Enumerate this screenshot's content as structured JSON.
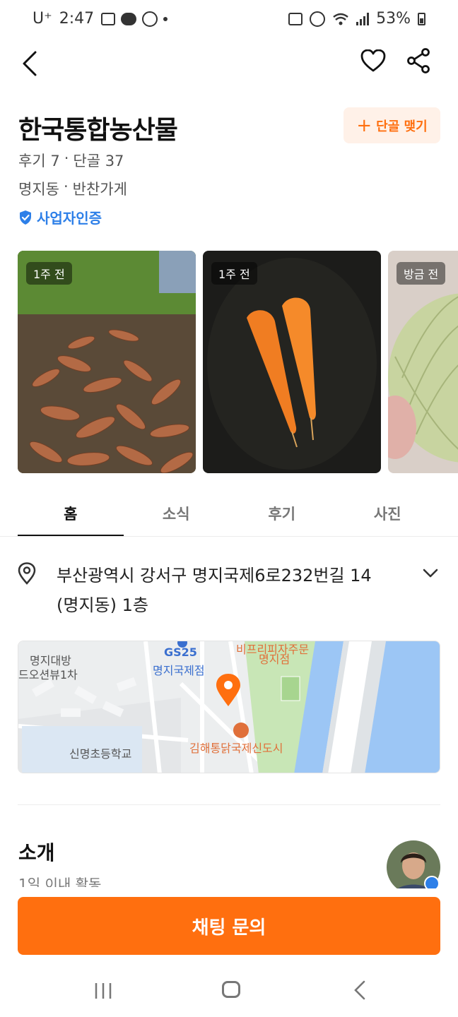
{
  "status_bar": {
    "carrier": "U⁺",
    "time": "2:47",
    "battery": "53%"
  },
  "header": {
    "back_icon": "chevron-left-icon",
    "like_icon": "heart-icon",
    "share_icon": "share-icon"
  },
  "store": {
    "name": "한국통합농산물",
    "regular_button": "단골 맺기",
    "reviews": "후기 7",
    "regulars": "단골 37",
    "neighborhood": "명지동",
    "category": "반찬가게",
    "verification": "사업자인증",
    "separator": "·"
  },
  "photos": [
    {
      "badge": "1주 전",
      "subject": "carrots-pile"
    },
    {
      "badge": "1주 전",
      "subject": "two-carrots"
    },
    {
      "badge": "방금 전",
      "subject": "onion"
    }
  ],
  "tabs": [
    {
      "label": "홈",
      "active": true
    },
    {
      "label": "소식",
      "active": false
    },
    {
      "label": "후기",
      "active": false
    },
    {
      "label": "사진",
      "active": false
    }
  ],
  "address": {
    "line1": "부산광역시 강서구 명지국제6로232번길 14",
    "line2": "(명지동) 1층"
  },
  "map": {
    "labels": {
      "gs_name": "GS25",
      "gs_branch": "명지국제점",
      "top_shop": "비프리피자주문",
      "top_shop_branch": "명지점",
      "apt_name": "명지대방",
      "apt_sub": "드오션뷰1차",
      "school": "신명초등학교",
      "restaurant": "김해통닭국제신도시"
    }
  },
  "intro": {
    "title": "소개",
    "subtitle": "1일 이내 활동"
  },
  "cta": {
    "label": "채팅 문의"
  },
  "colors": {
    "accent": "#ff6f0f",
    "verify": "#2d7fe8"
  }
}
